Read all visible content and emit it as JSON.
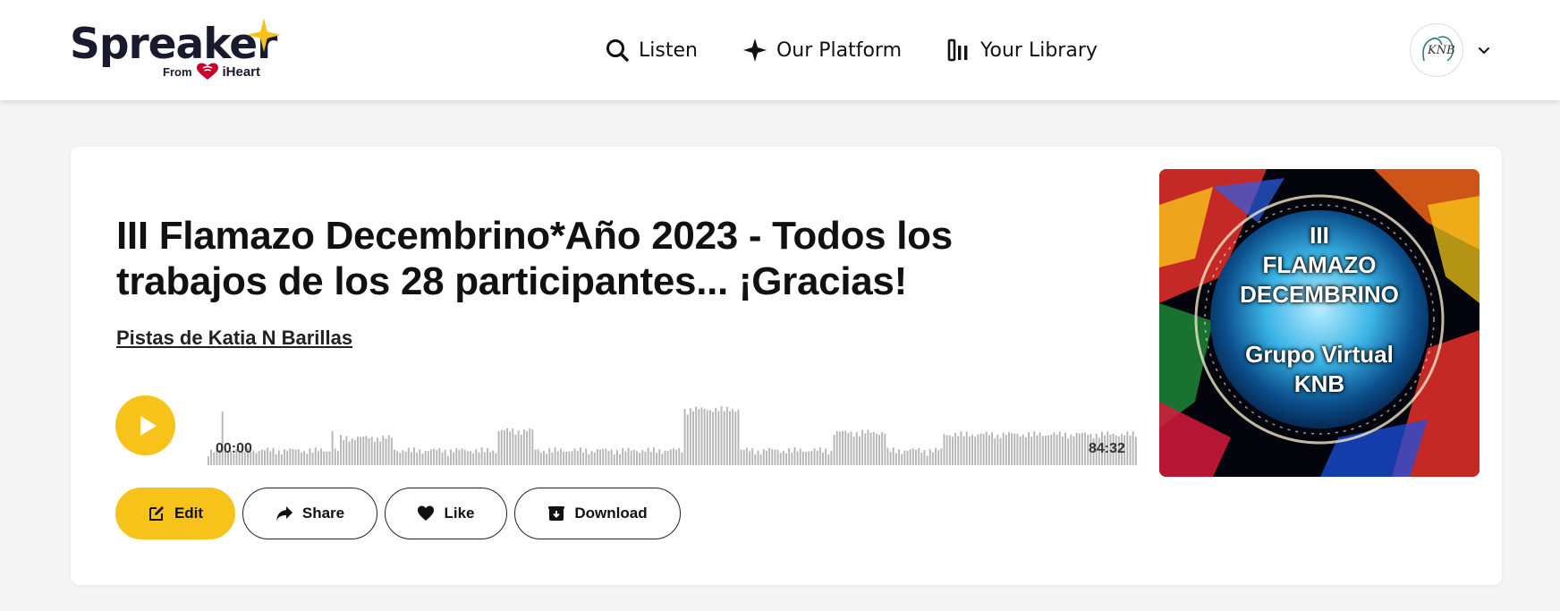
{
  "header": {
    "logo": {
      "wordmark": "Spreaker",
      "from": "From",
      "brand": "iHeart",
      "star_color": "#f7c31b"
    },
    "nav": [
      {
        "label": "Listen",
        "icon": "search-icon"
      },
      {
        "label": "Our Platform",
        "icon": "sparkle-icon"
      },
      {
        "label": "Your Library",
        "icon": "library-icon"
      }
    ],
    "user": {
      "avatar_text": "KNB",
      "menu_icon": "chevron-down-icon"
    }
  },
  "episode": {
    "title": "III Flamazo Decembrino*Año 2023 - Todos los trabajos de los 28 participantes... ¡Gracias!",
    "author": "Pistas de Katia N Barillas",
    "player": {
      "time_start": "00:00",
      "time_end": "84:32",
      "accent_color": "#f7c31b"
    },
    "actions": {
      "edit": "Edit",
      "share": "Share",
      "like": "Like",
      "download": "Download"
    },
    "cover": {
      "line1": "III",
      "line2": "FLAMAZO",
      "line3": "DECEMBRINO",
      "line4": "Grupo Virtual",
      "line5": "KNB"
    }
  }
}
